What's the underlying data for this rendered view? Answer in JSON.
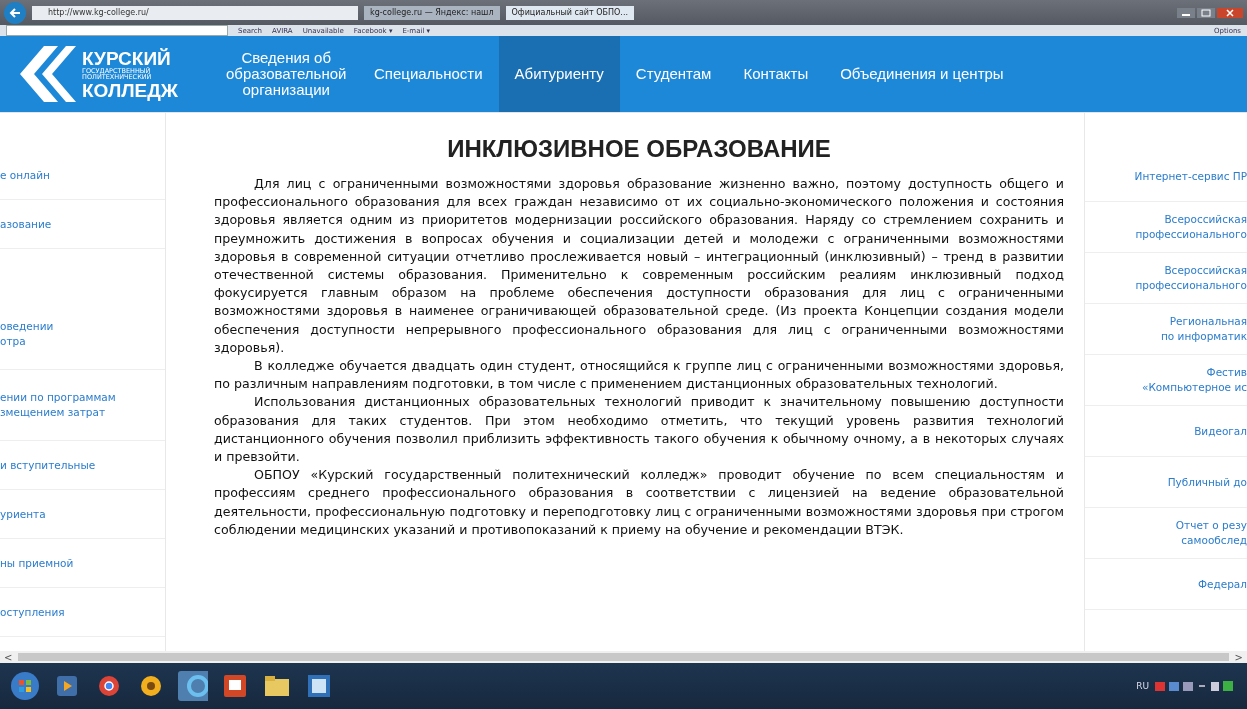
{
  "browser": {
    "address": "http://www.kg-college.ru/",
    "tabs": [
      {
        "label": "kg-college.ru — Яндекс: нашл",
        "selected": false
      },
      {
        "label": "Официальный сайт ОБПО...",
        "selected": true
      }
    ],
    "toolbar": [
      "Search",
      "AVIRA",
      "Unavailable",
      "Facebook ▾",
      "E-mail ▾"
    ],
    "options": "Options"
  },
  "header": {
    "logo": [
      "КУРСКИЙ",
      "ГОСУДАРСТВЕННЫЙ",
      "ПОЛИТЕХНИЧЕСКИЙ",
      "КОЛЛЕДЖ"
    ],
    "nav": [
      {
        "label": "Сведения об образовательной организации",
        "selected": false
      },
      {
        "label": "Специальности",
        "selected": false
      },
      {
        "label": "Абитуриенту",
        "selected": true
      },
      {
        "label": "Студентам",
        "selected": false
      },
      {
        "label": "Контакты",
        "selected": false
      },
      {
        "label": "Объединения и центры",
        "selected": false
      }
    ]
  },
  "left_menu": [
    [
      "е онлайн"
    ],
    [
      "азование"
    ],
    [
      "оведении",
      "отра"
    ],
    [
      "ении по программам",
      "змещением затрат"
    ],
    [
      "и вступительные"
    ],
    [
      "уриента"
    ],
    [
      "ны приемной"
    ],
    [
      "оступления"
    ]
  ],
  "article": {
    "title": "ИНКЛЮЗИВНОЕ ОБРАЗОВАНИЕ",
    "paragraphs": [
      "Для лиц с ограниченными возможностями здоровья образование жизненно важно, поэтому доступность общего и профессионального образования для всех граждан независимо от их социально-экономического положения и состояния здоровья является одним из приоритетов модернизации российского образования. Наряду со стремлением сохранить и преумножить достижения в вопросах обучения и социализации детей и молодежи с ограниченными возможностями здоровья в современной ситуации отчетливо прослеживается новый – интеграционный (инклюзивный) – тренд в развитии отечественной системы образования. Применительно к современным российским реалиям инклюзивный подход фокусируется главным образом на проблеме обеспечения доступности образования для лиц с ограниченными возможностями здоровья в наименее ограничивающей образовательной среде. (Из проекта Концепции создания модели обеспечения доступности непрерывного профессионального образования для лиц с ограниченными возможностями здоровья).",
      "В колледже обучается двадцать один студент, относящийся к группе лиц с ограниченными возможностями здоровья, по различным направлениям подготовки, в том числе с применением дистанционных образовательных технологий.",
      "Использования дистанционных образовательных технологий приводит к значительному повышению доступности образования для таких студентов. При этом необходимо отметить, что текущий уровень развития технологий дистанционного обучения позволил приблизить эффективность такого обучения к обычному очному, а в некоторых случаях и превзойти.",
      "ОБПОУ «Курский государственный политехнический колледж» проводит обучение по всем специальностям и профессиям среднего профессионального образования в соответствии с лицензией на ведение образовательной деятельности, профессиональную подготовку и переподготовку лиц с ограниченными возможностями здоровья при строгом соблюдении медицинских указаний и противопоказаний к приему на обучение и рекомендации ВТЭК."
    ]
  },
  "right_menu": [
    [
      "Интернет-сервис ПР"
    ],
    [
      "Всероссийская",
      "профессионального"
    ],
    [
      "Всероссийская",
      "профессионального"
    ],
    [
      "Региональная",
      "по информатик"
    ],
    [
      "Фестив",
      "«Компьютерное ис"
    ],
    [
      "Видеогал"
    ],
    [
      "Публичный до"
    ],
    [
      "Отчет о резу",
      "самообслед"
    ],
    [
      "Федерал"
    ]
  ],
  "scrollbar": {
    "left": "<",
    "right": ">"
  },
  "taskbar": {
    "language": "RU"
  }
}
